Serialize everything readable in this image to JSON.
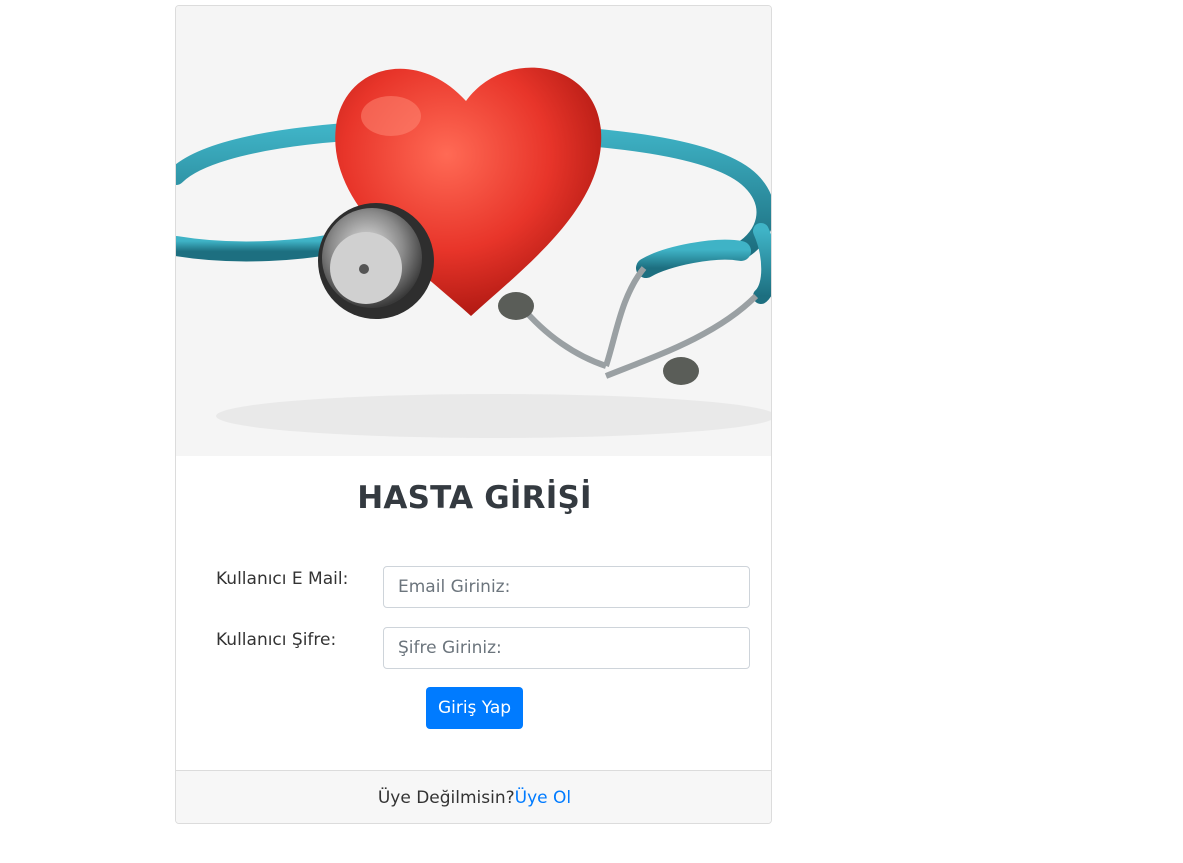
{
  "login": {
    "title": "HASTA GİRİŞİ",
    "email_label": "Kullanıcı E Mail:",
    "email_placeholder": "Email Giriniz:",
    "password_label": "Kullanıcı Şifre:",
    "password_placeholder": "Şifre Giriniz:",
    "submit_label": "Giriş Yap"
  },
  "footer": {
    "prompt": "Üye Değilmisin?",
    "register_link": "Üye Ol"
  },
  "colors": {
    "primary": "#007bff",
    "heart": "#e8352a",
    "tube": "#2a8fa3"
  }
}
